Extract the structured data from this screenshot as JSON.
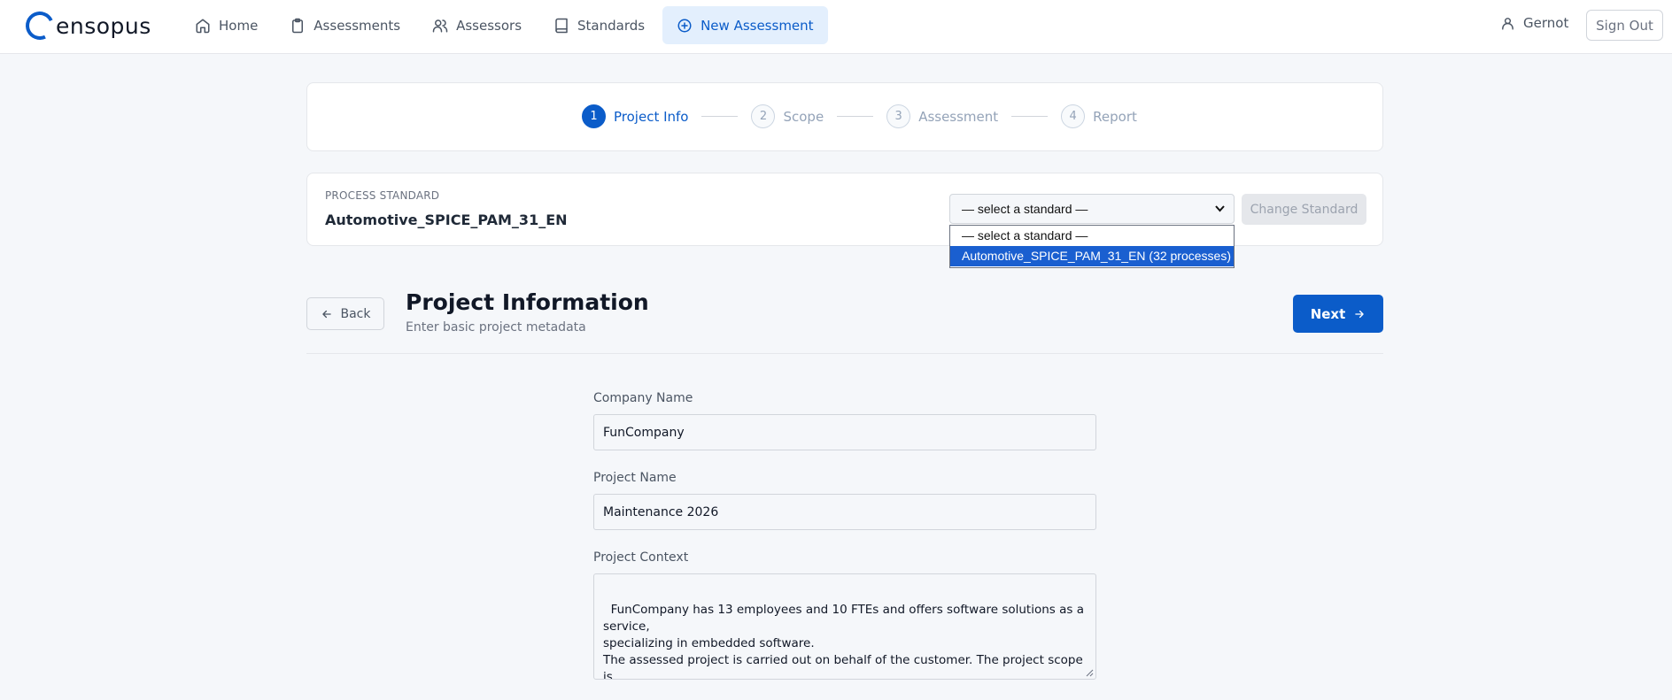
{
  "app": {
    "brand": "ensopus",
    "colors": {
      "accent": "#0b5cc9",
      "accent_light": "#e3effd",
      "background": "#f5f7fa"
    }
  },
  "nav": {
    "items": [
      {
        "label": "Home",
        "icon": "home-icon"
      },
      {
        "label": "Assessments",
        "icon": "clipboard-icon"
      },
      {
        "label": "Assessors",
        "icon": "users-icon"
      },
      {
        "label": "Standards",
        "icon": "book-icon"
      },
      {
        "label": "New Assessment",
        "icon": "plus-circle-icon",
        "active": true
      }
    ],
    "user": "Gernot",
    "signout": "Sign Out"
  },
  "stepper": {
    "steps": [
      {
        "num": "1",
        "label": "Project Info",
        "active": true
      },
      {
        "num": "2",
        "label": "Scope"
      },
      {
        "num": "3",
        "label": "Assessment"
      },
      {
        "num": "4",
        "label": "Report"
      }
    ]
  },
  "standard": {
    "caption": "PROCESS STANDARD",
    "name": "Automotive_SPICE_PAM_31_EN",
    "select_value": "— select a standard —",
    "change_button": "Change Standard",
    "options": [
      {
        "label": "— select a standard —"
      },
      {
        "label": "Automotive_SPICE_PAM_31_EN (32 processes)",
        "selected": true
      }
    ]
  },
  "page": {
    "back": "Back",
    "title": "Project Information",
    "subtitle": "Enter basic project metadata",
    "next": "Next"
  },
  "form": {
    "company_label": "Company Name",
    "company_value": "FunCompany",
    "project_label": "Project Name",
    "project_value": "Maintenance 2026",
    "context_label": "Project Context",
    "context_value": "FunCompany has 13 employees and 10 FTEs and offers software solutions as a service,\nspecializing in embedded software.\nThe assessed project is carried out on behalf of the customer. The project scope is\ndynamic and is defined based on releases."
  }
}
